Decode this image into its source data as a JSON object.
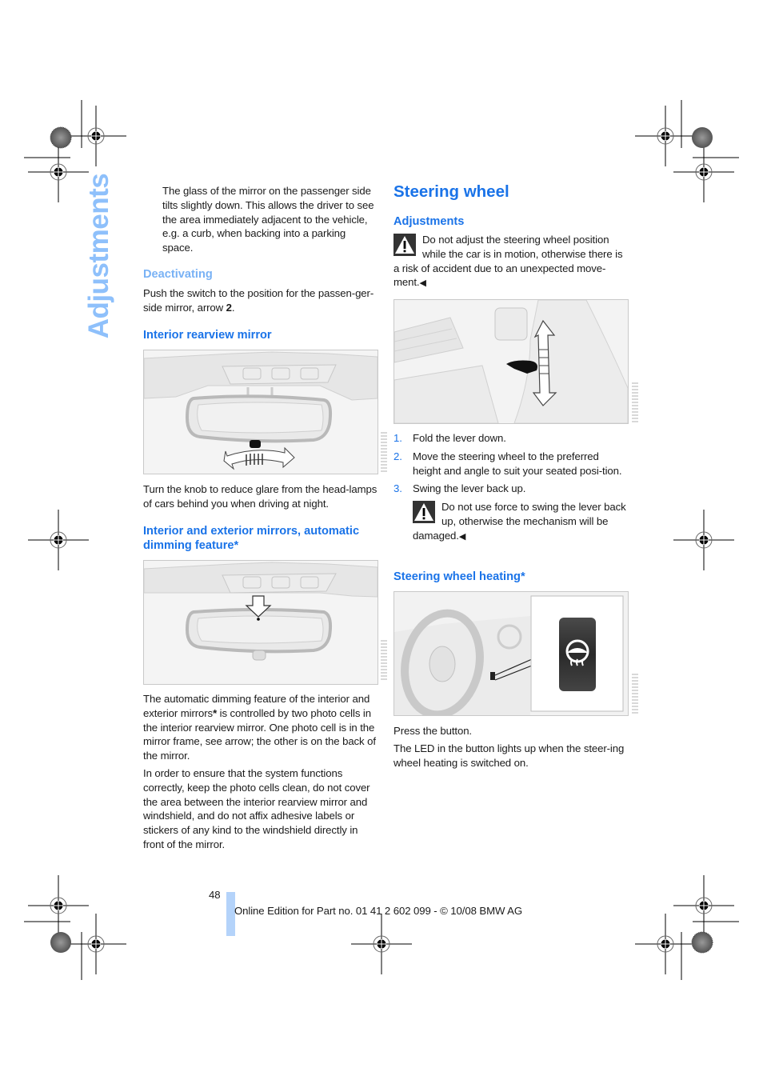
{
  "side_title": "Adjustments",
  "left_column": {
    "intro_paragraph": "The glass of the mirror on the passenger side tilts slightly down. This allows the driver to see the area immediately adjacent to the vehicle, e.g. a curb, when backing into a parking space.",
    "deactivating": {
      "heading": "Deactivating",
      "text_before": "Push the switch to the position for the passen-ger-side mirror, arrow ",
      "arrow_number": "2",
      "text_after": "."
    },
    "interior_mirror": {
      "heading": "Interior rearview mirror",
      "figure_label": "interior rearview mirror with dimming knob",
      "paragraph": "Turn the knob to reduce glare from the head-lamps of cars behind you when driving at night."
    },
    "auto_dimming": {
      "heading": "Interior and exterior mirrors, automatic dimming feature*",
      "figure_label": "rearview mirror photo cell arrow",
      "paragraph1_a": "The automatic dimming feature of the interior and exterior mirrors",
      "paragraph1_star": "*",
      "paragraph1_b": " is controlled by two photo cells in the interior rearview mirror. One photo cell is in the mirror frame, see arrow; the other is on the back of the mirror.",
      "paragraph2": "In order to ensure that the system functions correctly, keep the photo cells clean, do not cover the area between the interior rearview mirror and windshield, and do not affix adhesive labels or stickers of any kind to the windshield directly in front of the mirror."
    }
  },
  "right_column": {
    "section_title": "Steering wheel",
    "adjustments": {
      "heading": "Adjustments",
      "warning": "Do not adjust the steering wheel position while the car is in motion, otherwise there is a risk of accident due to an unexpected move-ment.",
      "end_mark": "◀",
      "figure_label": "steering column adjustment lever",
      "steps": [
        {
          "num": "1.",
          "text": "Fold the lever down."
        },
        {
          "num": "2.",
          "text": "Move the steering wheel to the preferred height and angle to suit your seated posi-tion."
        },
        {
          "num": "3.",
          "text": "Swing the lever back up."
        }
      ],
      "step3_warning": "Do not use force to swing the lever back up, otherwise the mechanism will be damaged."
    },
    "heating": {
      "heading": "Steering wheel heating*",
      "figure_label": "steering wheel heating button",
      "text1": "Press the button.",
      "text2": "The LED in the button lights up when the steer-ing wheel heating is switched on."
    }
  },
  "footer": {
    "page_number": "48",
    "edition": "Online Edition for Part no. 01 41 2 602 099 - © 10/08 BMW AG"
  },
  "colors": {
    "heading_blue": "#1a73e8",
    "side_title_blue": "#8ec0fb",
    "footer_bar": "#b4d3fa"
  }
}
